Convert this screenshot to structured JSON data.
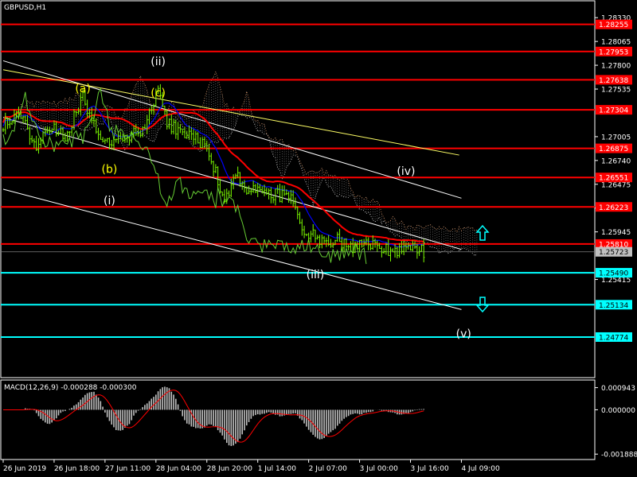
{
  "chart_title": "GBPUSD,H1",
  "macd_label": "MACD(12,26,9) -0.000288 -0.000300",
  "colors": {
    "background": "#000000",
    "candles": "#7cfc00",
    "red_lines": "#ff0000",
    "cyan_lines": "#00ffff",
    "ma_red": "#ff0000",
    "ma_blue": "#0000ff",
    "chikou": "#66cc33",
    "channel": "#ffffff",
    "yellow_trend": "#ffff66",
    "cloud": "#cccccc",
    "macd_hist": "#c0c0c0",
    "macd_signal": "#ff0000",
    "wave_white": "#ffffff",
    "wave_yellow": "#ffff00"
  },
  "chart_data": {
    "type": "line",
    "symbol": "GBPUSD",
    "timeframe": "H1",
    "xlabels": [
      "26 Jun 2019",
      "26 Jun 18:00",
      "27 Jun 11:00",
      "28 Jun 04:00",
      "28 Jun 20:00",
      "1 Jul 14:00",
      "2 Jul 07:00",
      "3 Jul 00:00",
      "3 Jul 16:00",
      "4 Jul 09:00"
    ],
    "price_ticks": [
      "1.28330",
      "1.28065",
      "1.27800",
      "1.27535",
      "1.27005",
      "1.26740",
      "1.26475",
      "1.26210",
      "1.25945",
      "1.25415"
    ],
    "ylim": [
      1.2434,
      1.285
    ],
    "current_price": "1.25723",
    "red_levels": [
      {
        "label": "1.28255",
        "price": 1.28255
      },
      {
        "label": "1.27953",
        "price": 1.27953
      },
      {
        "label": "1.27638",
        "price": 1.27638
      },
      {
        "label": "1.27304",
        "price": 1.27304
      },
      {
        "label": "1.26875",
        "price": 1.26875
      },
      {
        "label": "1.26551",
        "price": 1.26551
      },
      {
        "label": "1.26223",
        "price": 1.26223
      },
      {
        "label": "1.25810",
        "price": 1.2581
      }
    ],
    "cyan_levels": [
      {
        "label": "1.25490",
        "price": 1.2549
      },
      {
        "label": "1.25134",
        "price": 1.25134
      },
      {
        "label": "1.24774",
        "price": 1.24774
      }
    ],
    "wave_labels": [
      {
        "text": "(ii)",
        "bar": 70,
        "price": 1.278,
        "color": "white"
      },
      {
        "text": "(a)",
        "bar": 36,
        "price": 1.275,
        "color": "yellow"
      },
      {
        "text": "(c)",
        "bar": 70,
        "price": 1.2745,
        "color": "yellow"
      },
      {
        "text": "(b)",
        "bar": 48,
        "price": 1.266,
        "color": "yellow"
      },
      {
        "text": "(i)",
        "bar": 48,
        "price": 1.2625,
        "color": "white"
      },
      {
        "text": "(iv)",
        "bar": 182,
        "price": 1.2658,
        "color": "white"
      },
      {
        "text": "(iii)",
        "bar": 141,
        "price": 1.2543,
        "color": "white"
      },
      {
        "text": "(v)",
        "bar": 208,
        "price": 1.2477,
        "color": "white"
      }
    ],
    "macd": {
      "ticks": [
        "0.000943",
        "0.000000",
        "-0.001888"
      ],
      "ylim": [
        -0.00205,
        0.0012
      ]
    }
  }
}
